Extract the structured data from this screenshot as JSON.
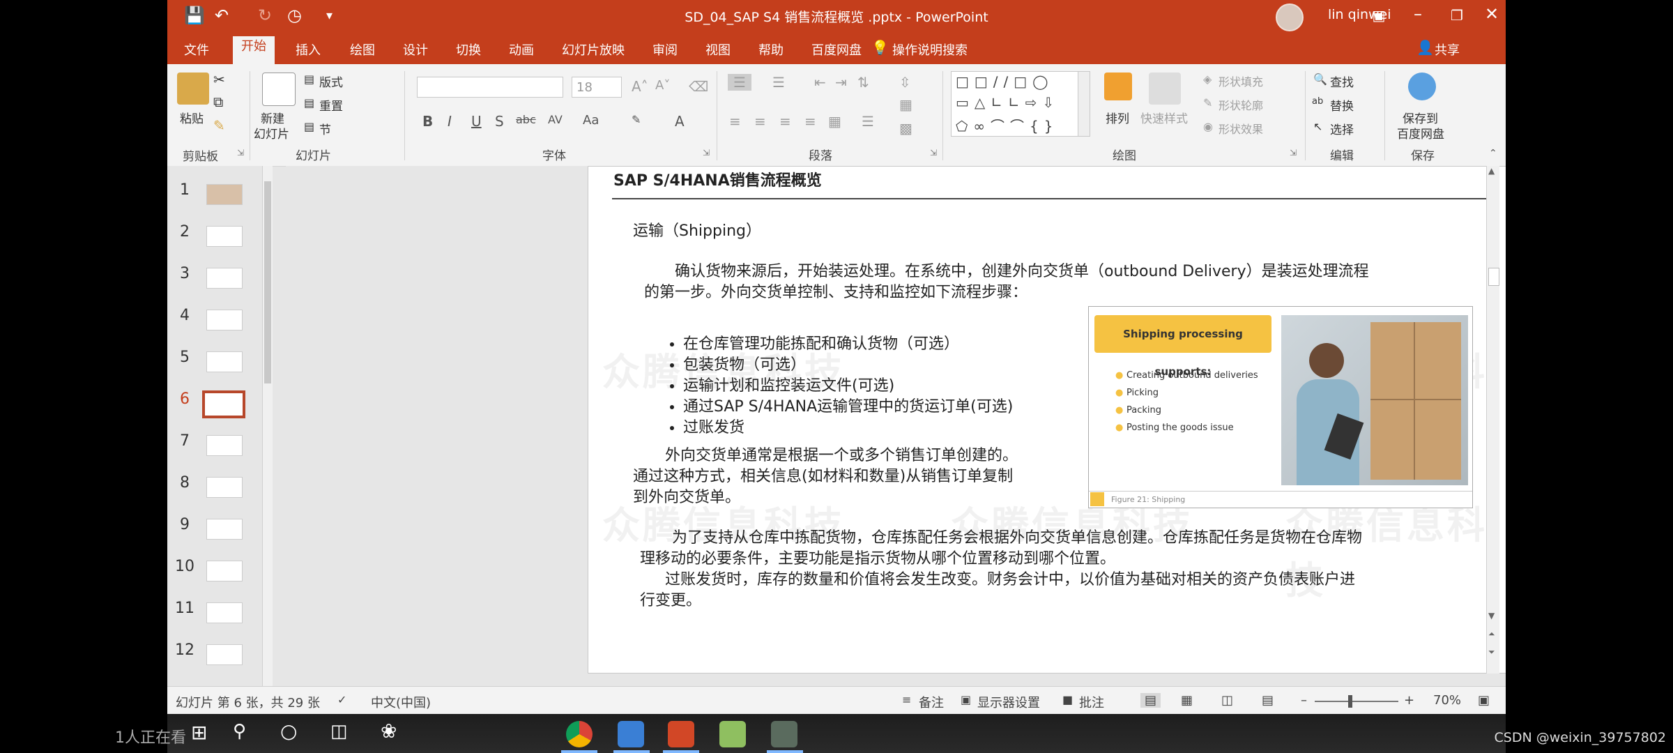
{
  "window": {
    "title": "SD_04_SAP S4 销售流程概览 .pptx  -  PowerPoint",
    "user": "lin qinwei"
  },
  "tabs": [
    "文件",
    "开始",
    "插入",
    "绘图",
    "设计",
    "切换",
    "动画",
    "幻灯片放映",
    "审阅",
    "视图",
    "帮助",
    "百度网盘"
  ],
  "active_tab": "开始",
  "tell_me": "操作说明搜索",
  "share": "共享",
  "ribbon": {
    "clipboard": {
      "paste": "粘贴",
      "label": "剪贴板"
    },
    "slides": {
      "new_slide_1": "新建",
      "new_slide_2": "幻灯片",
      "layout": "版式",
      "reset": "重置",
      "section": "节",
      "label": "幻灯片"
    },
    "font": {
      "size": "18",
      "label": "字体",
      "buttons": [
        "B",
        "I",
        "U",
        "S",
        "abc",
        "AV",
        "Aa",
        "A"
      ]
    },
    "paragraph": {
      "label": "段落"
    },
    "drawing": {
      "arrange": "排列",
      "quick_styles": "快速样式",
      "shape_fill": "形状填充",
      "shape_outline": "形状轮廓",
      "shape_effects": "形状效果",
      "label": "绘图"
    },
    "editing": {
      "find": "查找",
      "replace": "替换",
      "select": "选择",
      "label": "编辑"
    },
    "save": {
      "save_1": "保存到",
      "save_2": "百度网盘",
      "label": "保存"
    }
  },
  "thumbnails": [
    "1",
    "2",
    "3",
    "4",
    "5",
    "6",
    "7",
    "8",
    "9",
    "10",
    "11",
    "12"
  ],
  "active_slide": "6",
  "slide": {
    "title": "SAP S/4HANA销售流程概览",
    "heading": "运输（Shipping）",
    "para1_line1": "确认货物来源后，开始装运处理。在系统中，创建外向交货单（outbound Delivery）是装运处理流程",
    "para1_line2": "的第一步。外向交货单控制、支持和监控如下流程步骤：",
    "bullets": [
      "在仓库管理功能拣配和确认货物（可选）",
      "包装货物（可选）",
      "运输计划和监控装运文件(可选)",
      "通过SAP S/4HANA运输管理中的货运订单(可选)",
      "过账发货"
    ],
    "para2_line1": "外向交货单通常是根据一个或多个销售订单创建的。",
    "para2_line2": "通过这种方式，相关信息(如材料和数量)从销售订单复制",
    "para2_line3": "到外向交货单。",
    "para3_line1": "为了支持从仓库中拣配货物，仓库拣配任务会根据外向交货单信息创建。仓库拣配任务是货物在仓库物",
    "para3_line2": "理移动的必要条件，主要功能是指示货物从哪个位置移动到哪个位置。",
    "para4_line1": "过账发货时，库存的数量和价值将会发生改变。财务会计中，以价值为基础对相关的资产负债表账户进",
    "para4_line2": "行变更。",
    "watermark": "众腾信息科技",
    "figure": {
      "banner": "Shipping processing supports:",
      "items": [
        "Creating outbound deliveries",
        "Picking",
        "Packing",
        "Posting the goods issue"
      ],
      "caption": "Figure 21: Shipping"
    }
  },
  "status": {
    "slide_info": "幻灯片 第 6 张，共 29 张",
    "language": "中文(中国)",
    "notes": "备注",
    "display": "显示器设置",
    "comments": "批注",
    "zoom": "70%"
  },
  "overlay": {
    "left": "1人正在看",
    "right": "CSDN @weixin_39757802"
  }
}
